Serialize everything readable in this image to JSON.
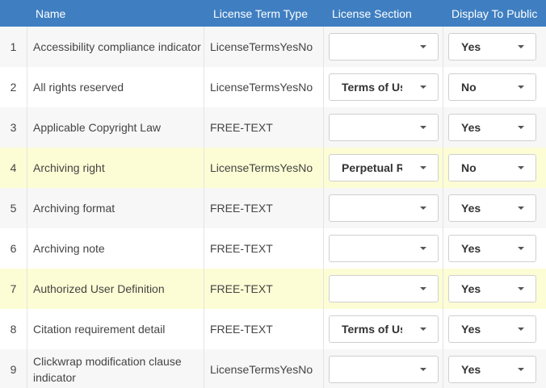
{
  "columns": {
    "name": "Name",
    "type": "License Term Type",
    "section": "License Section",
    "public": "Display To Public"
  },
  "rows": [
    {
      "idx": "1",
      "name": "Accessibility compliance indicator",
      "type": "LicenseTermsYesNo",
      "section": "",
      "public": "Yes",
      "style": "alt"
    },
    {
      "idx": "2",
      "name": "All rights reserved",
      "type": "LicenseTermsYesNo",
      "section": "Terms of Use",
      "public": "No",
      "style": ""
    },
    {
      "idx": "3",
      "name": "Applicable Copyright Law",
      "type": "FREE-TEXT",
      "section": "",
      "public": "Yes",
      "style": "alt"
    },
    {
      "idx": "4",
      "name": "Archiving right",
      "type": "LicenseTermsYesNo",
      "section": "Perpetual Rights",
      "public": "No",
      "style": "highlight"
    },
    {
      "idx": "5",
      "name": "Archiving format",
      "type": "FREE-TEXT",
      "section": "",
      "public": "Yes",
      "style": "alt"
    },
    {
      "idx": "6",
      "name": "Archiving note",
      "type": "FREE-TEXT",
      "section": "",
      "public": "Yes",
      "style": ""
    },
    {
      "idx": "7",
      "name": "Authorized User Definition",
      "type": "FREE-TEXT",
      "section": "",
      "public": "Yes",
      "style": "highlight"
    },
    {
      "idx": "8",
      "name": "Citation requirement detail",
      "type": "FREE-TEXT",
      "section": "Terms of Use",
      "public": "Yes",
      "style": ""
    },
    {
      "idx": "9",
      "name": "Clickwrap modification clause indicator",
      "type": "LicenseTermsYesNo",
      "section": "",
      "public": "Yes",
      "style": "alt"
    }
  ]
}
